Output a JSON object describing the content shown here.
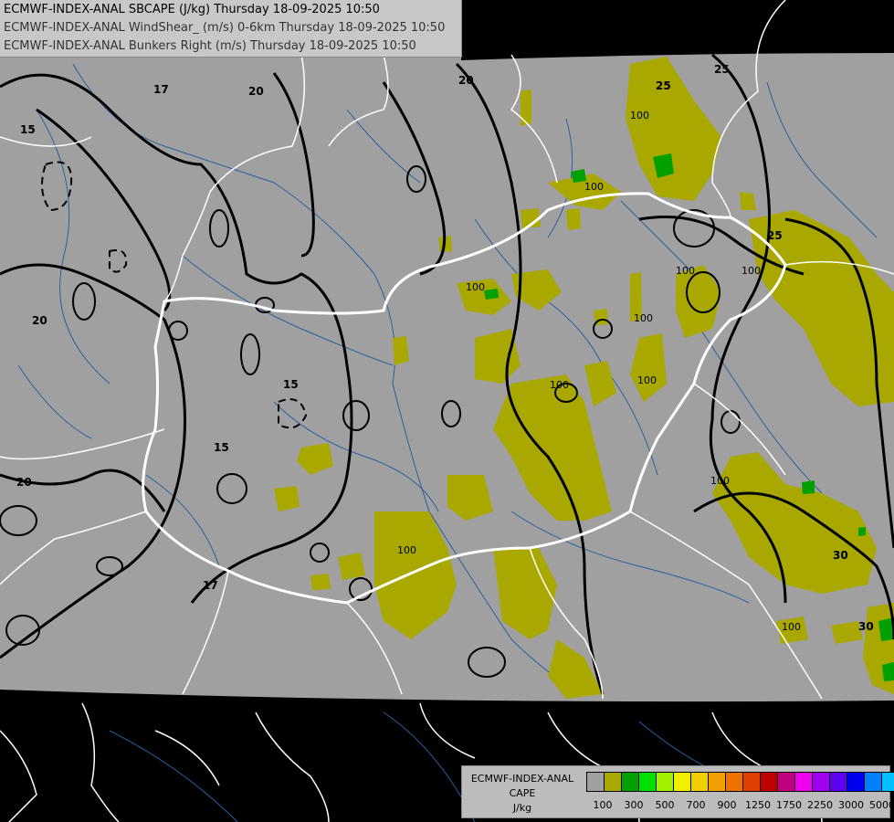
{
  "header": {
    "line1": "ECMWF-INDEX-ANAL SBCAPE (J/kg) Thursday 18-09-2025 10:50",
    "line2": "ECMWF-INDEX-ANAL WindShear_ (m/s) 0-6km Thursday 18-09-2025 10:50",
    "line3": "ECMWF-INDEX-ANAL Bunkers Right (m/s) Thursday 18-09-2025 10:50"
  },
  "legend": {
    "title1": "ECMWF-INDEX-ANAL",
    "title2": "CAPE",
    "unit": "J/kg",
    "colors": [
      "#a0a0a0",
      "#a8a800",
      "#00a000",
      "#00e000",
      "#a0f000",
      "#f0f000",
      "#f0d000",
      "#f0a000",
      "#f07000",
      "#e04000",
      "#c00000",
      "#c00080",
      "#f000f0",
      "#a000f0",
      "#6000f0",
      "#0000f0",
      "#0080ff",
      "#00c0ff",
      "#40ffff",
      "#ffffff"
    ],
    "ticks": [
      "100",
      "300",
      "500",
      "700",
      "900",
      "1250",
      "1750",
      "2250",
      "3000",
      "5000"
    ]
  },
  "map": {
    "colors": {
      "outside": "#000000",
      "domain": "#a0a0a0",
      "cape_low": "#a8a800",
      "cape_mid": "#00a000",
      "cape_high": "#00e000",
      "borders": "#ffffff",
      "rivers": "#2a5f9e"
    },
    "shear_labels": [
      "17",
      "20",
      "15",
      "20",
      "20",
      "15",
      "15",
      "20",
      "17",
      "25",
      "25",
      "25",
      "30",
      "30"
    ],
    "cape_labels": [
      "100",
      "100",
      "100",
      "100",
      "100",
      "100",
      "100",
      "100",
      "100",
      "100",
      "100"
    ]
  }
}
